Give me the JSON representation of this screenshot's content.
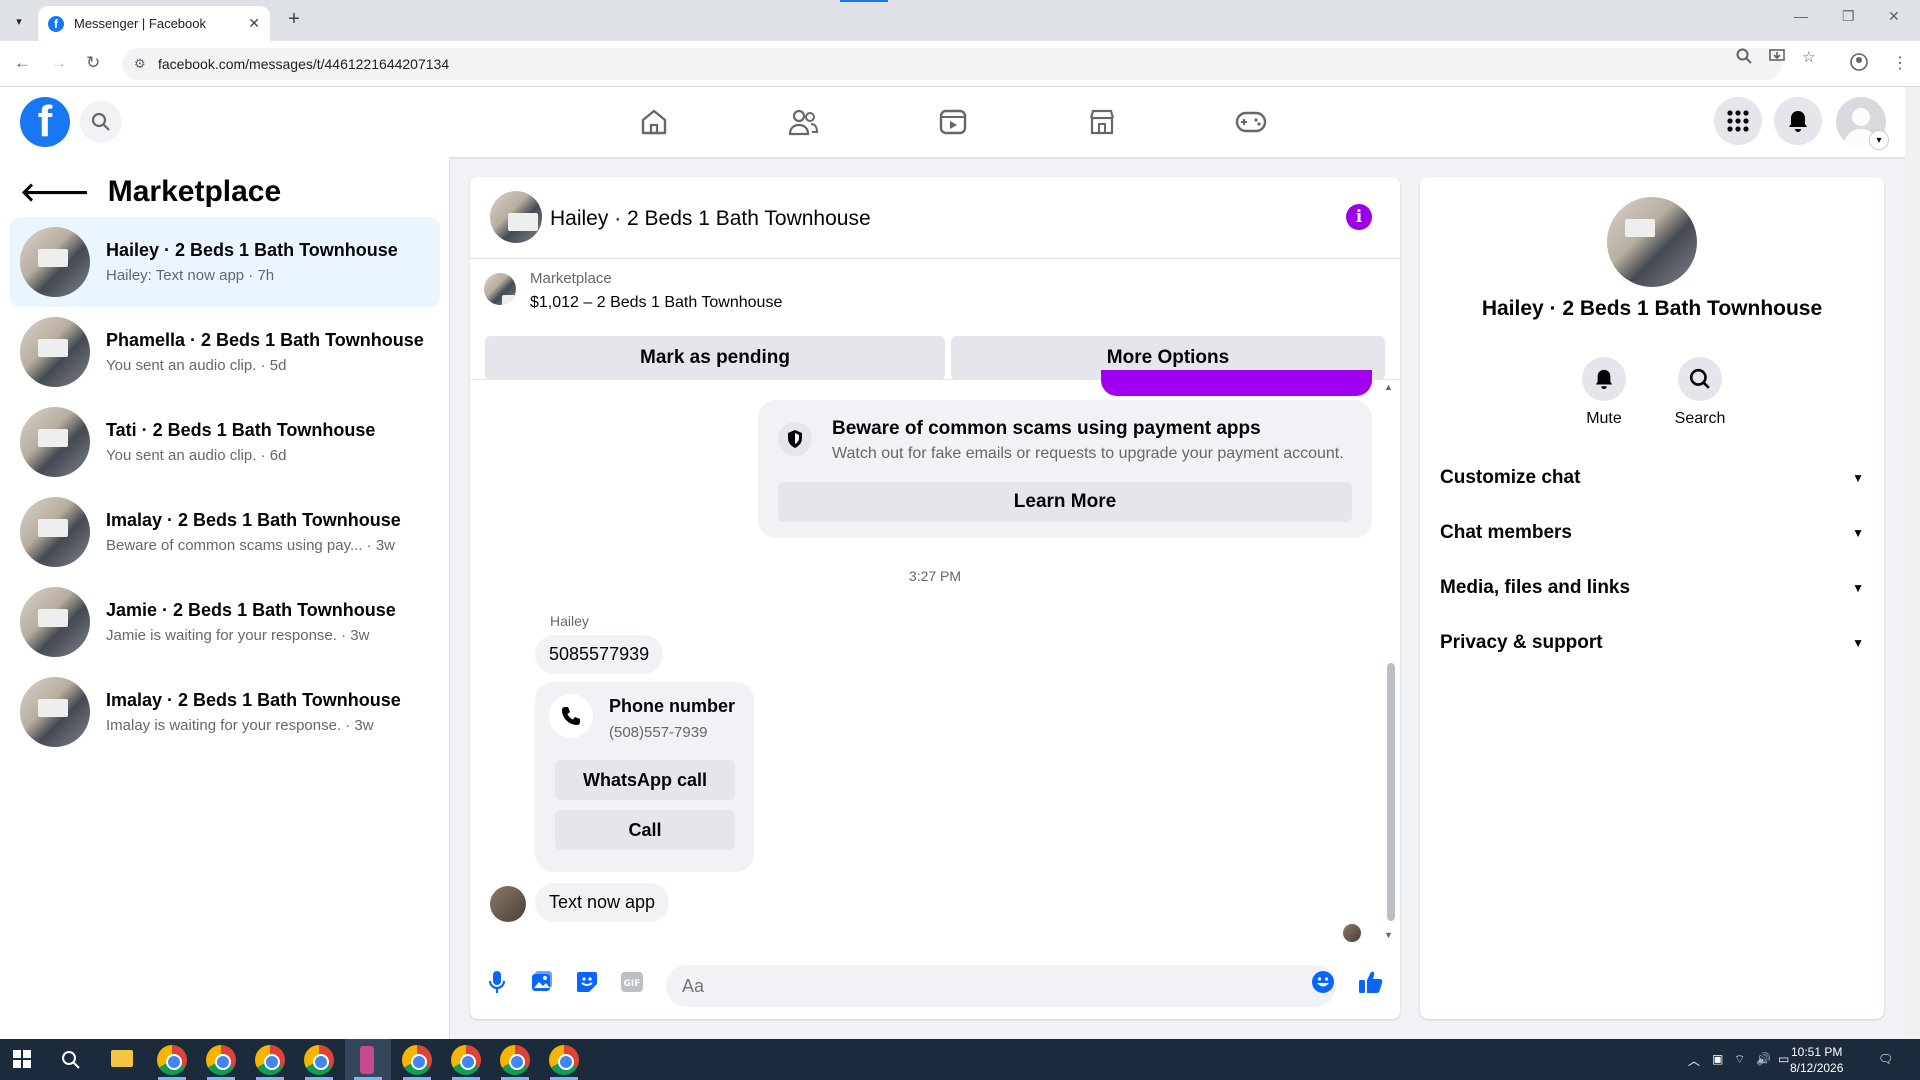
{
  "browser": {
    "tab_title": "Messenger | Facebook",
    "url": "facebook.com/messages/t/4461221644207134",
    "accent": "#1a73e8"
  },
  "fb": {
    "logo_letter": "f",
    "brand_color": "#1877f2"
  },
  "left": {
    "title": "Marketplace",
    "conversations": [
      {
        "name": "Hailey · 2 Beds 1 Bath Townhouse",
        "preview": "Hailey: Text now app · 7h"
      },
      {
        "name": "Phamella · 2 Beds 1 Bath Townhouse",
        "preview": "You sent an audio clip. · 5d"
      },
      {
        "name": "Tati · 2 Beds 1 Bath Townhouse",
        "preview": "You sent an audio clip. · 6d"
      },
      {
        "name": "Imalay · 2 Beds 1 Bath Townhouse",
        "preview": "Beware of common scams using pay...  · 3w"
      },
      {
        "name": "Jamie · 2 Beds 1 Bath Townhouse",
        "preview": "Jamie is waiting for your response. · 3w"
      },
      {
        "name": "Imalay · 2 Beds 1 Bath Townhouse",
        "preview": "Imalay is waiting for your response. · 3w"
      }
    ]
  },
  "chat": {
    "title": "Hailey · 2 Beds 1 Bath Townhouse",
    "marketplace_label": "Marketplace",
    "listing": "$1,012 – 2 Beds 1 Bath Townhouse",
    "mark_pending": "Mark as pending",
    "more_options": "More Options",
    "scam_title": "Beware of common scams using payment apps",
    "scam_desc": "Watch out for fake emails or requests to upgrade your payment account.",
    "learn_more": "Learn More",
    "timestamp": "3:27 PM",
    "sender": "Hailey",
    "msg_number": "5085577939",
    "phone_title": "Phone number",
    "phone_formatted": "(508)557-7939",
    "whatsapp_call": "WhatsApp call",
    "call": "Call",
    "msg_last": "Text now app",
    "input_placeholder": "Aa",
    "accent": "#9b00e8"
  },
  "right": {
    "name": "Hailey · 2 Beds 1 Bath Townhouse",
    "mute": "Mute",
    "search": "Search",
    "sections": [
      "Customize chat",
      "Chat members",
      "Media, files and links",
      "Privacy & support"
    ]
  },
  "taskbar": {
    "time": "10:51 PM",
    "date": "8/12/2026"
  }
}
